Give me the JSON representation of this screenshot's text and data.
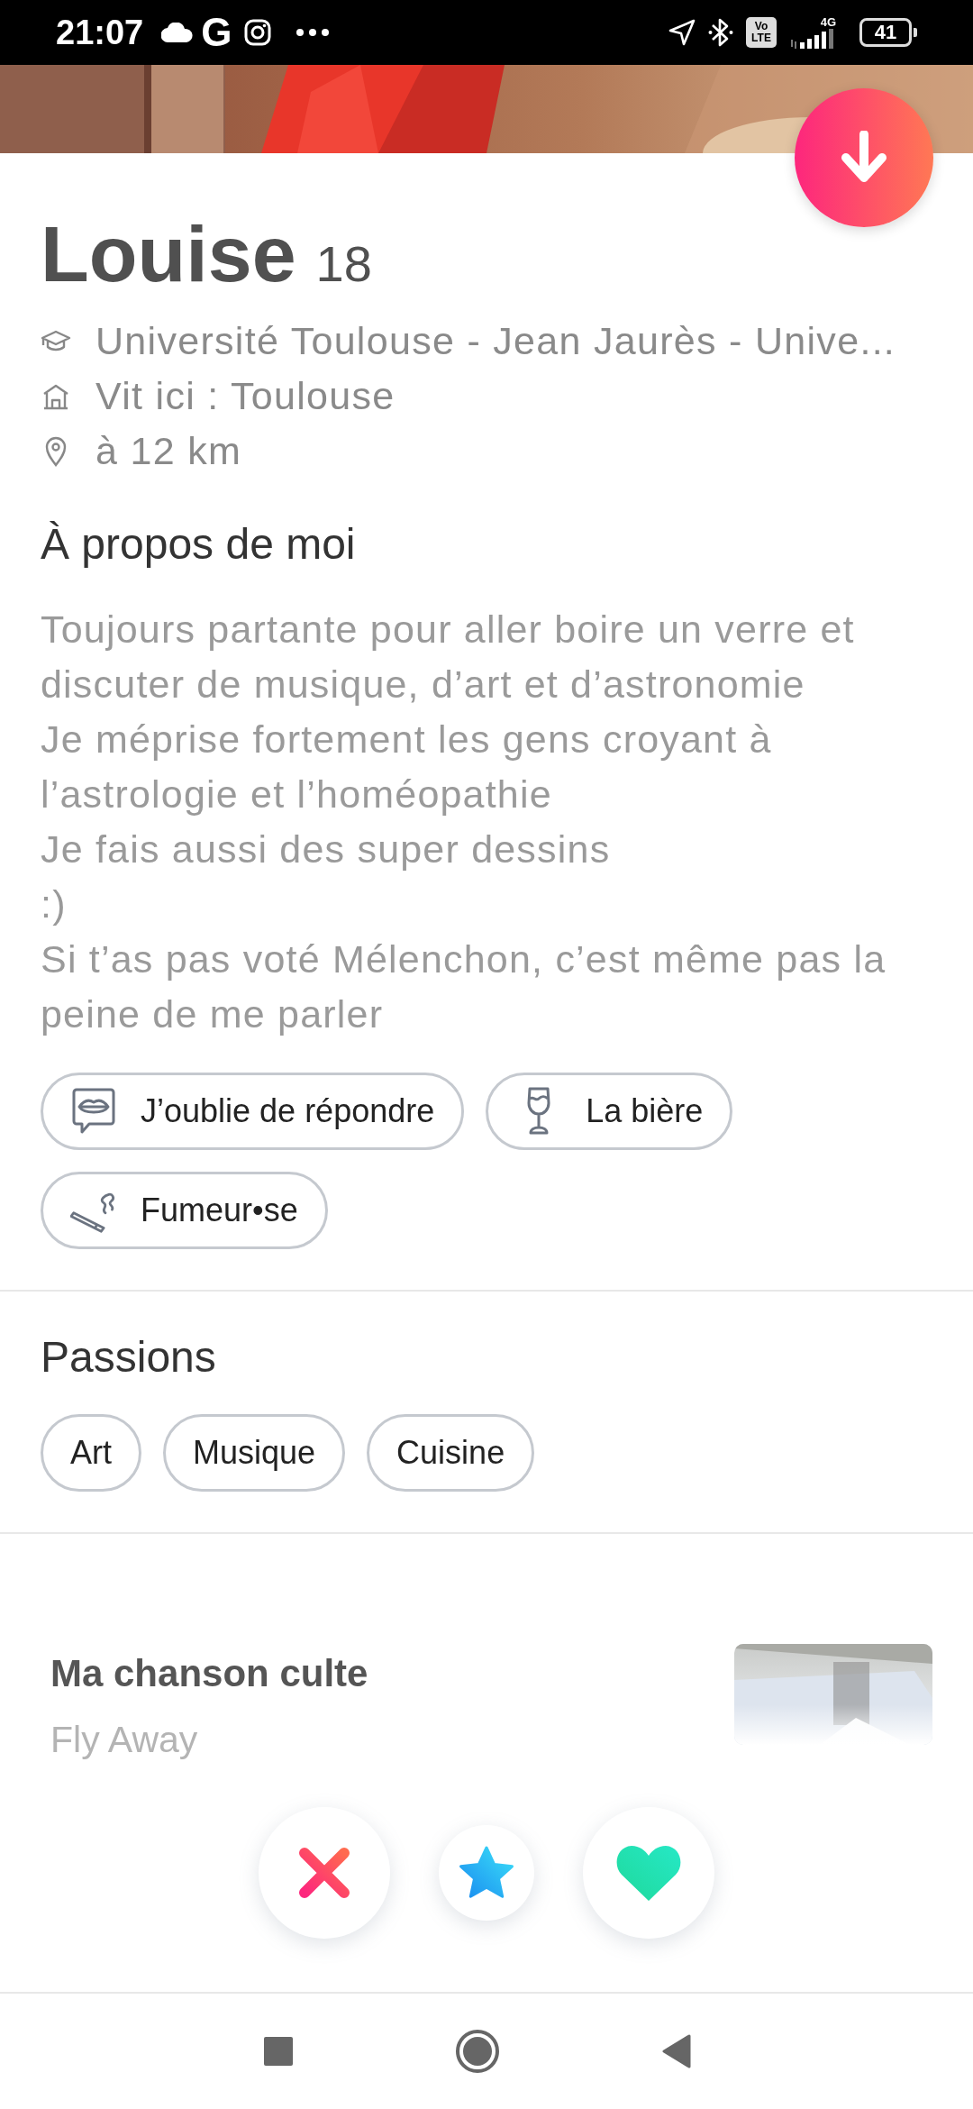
{
  "status_bar": {
    "time": "21:07",
    "app_letter": "G",
    "network": "4G",
    "volte_top": "Vo",
    "volte_bottom": "LTE",
    "battery": "41"
  },
  "profile": {
    "name": "Louise",
    "age": "18",
    "info": [
      {
        "kind": "school",
        "text": "Université Toulouse - Jean Jaurès - Unive..."
      },
      {
        "kind": "home",
        "text": "Vit ici : Toulouse"
      },
      {
        "kind": "distance",
        "text": "à 12 km"
      }
    ]
  },
  "about": {
    "title": "À propos de moi",
    "bio": [
      "Toujours partante pour aller boire un verre et discuter de musique, d’art et d’astronomie",
      "Je méprise fortement les gens croyant à l’astrologie et l’homéopathie",
      "Je fais aussi des super dessins",
      ":)",
      "Si t’as pas voté Mélenchon, c’est même pas la peine de me parler"
    ],
    "chips": [
      {
        "kind": "lips",
        "label": "J’oublie de répondre"
      },
      {
        "kind": "glass",
        "label": "La bière"
      },
      {
        "kind": "cigarette",
        "label": "Fumeur•se"
      }
    ]
  },
  "passions": {
    "title": "Passions",
    "chips": [
      "Art",
      "Musique",
      "Cuisine"
    ]
  },
  "song": {
    "title": "Ma chanson culte",
    "track": "Fly Away"
  },
  "actions": [
    {
      "kind": "nope"
    },
    {
      "kind": "super"
    },
    {
      "kind": "like"
    }
  ]
}
